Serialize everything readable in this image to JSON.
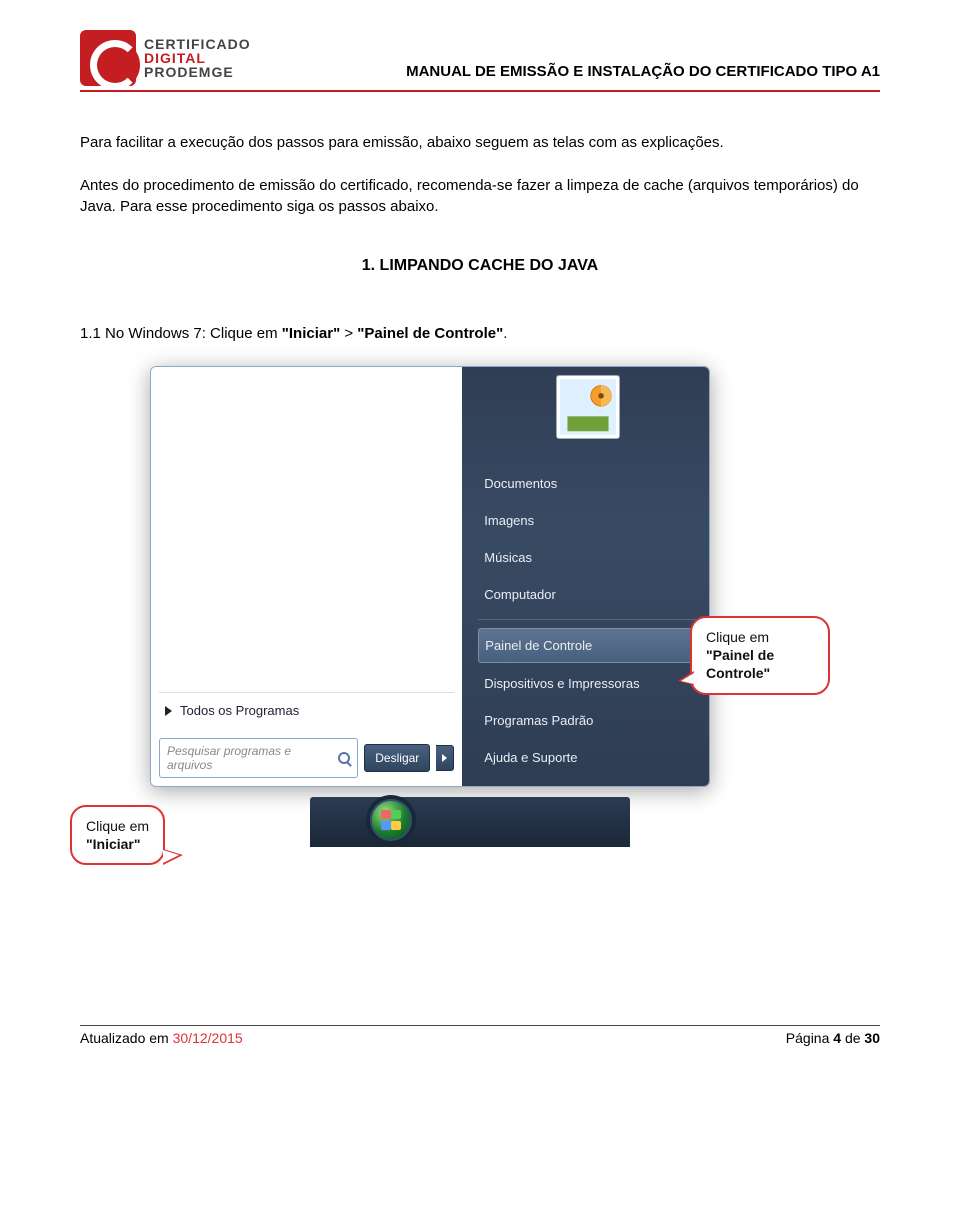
{
  "logo": {
    "line1": "CERTIFICADO",
    "line2": "DIGITAL",
    "line3": "PRODEMGE"
  },
  "doc_title_prefix": "MANUAL DE EMISSÃO E INSTALAÇÃO DO CERTIFICADO ",
  "doc_title_suffix": "TIPO A1",
  "para1": "Para facilitar a execução dos passos para emissão, abaixo seguem as telas com as explicações.",
  "para2": "Antes do procedimento de emissão do certificado, recomenda-se fazer a limpeza de cache (arquivos temporários) do Java. Para esse procedimento siga os passos abaixo.",
  "section_heading": "1. LIMPANDO CACHE DO JAVA",
  "step": {
    "prefix": "1.1 No Windows 7: Clique em ",
    "bold1": "\"Iniciar\"",
    "mid": " > ",
    "bold2": "\"Painel de Controle\"",
    "suffix": "."
  },
  "start_menu": {
    "right_items": [
      "Documentos",
      "Imagens",
      "Músicas",
      "Computador"
    ],
    "right_items2": [
      "Painel de Controle",
      "Dispositivos e Impressoras",
      "Programas Padrão",
      "Ajuda e Suporte"
    ],
    "all_programs": "Todos os Programas",
    "search_placeholder": "Pesquisar programas e arquivos",
    "shutdown": "Desligar"
  },
  "callout1": {
    "line1": "Clique em",
    "line2": "\"Painel de Controle\""
  },
  "callout2": {
    "line1": "Clique em",
    "line2": "\"Iniciar\""
  },
  "footer": {
    "updated_label": "Atualizado em ",
    "updated_date": "30/12/2015",
    "page_label": "Página ",
    "page_num": "4",
    "page_of": " de ",
    "page_total": "30"
  }
}
